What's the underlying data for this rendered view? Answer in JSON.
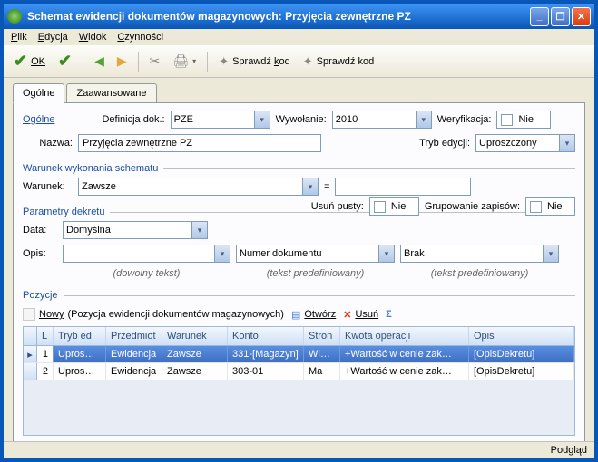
{
  "window": {
    "title": "Schemat ewidencji dokumentów magazynowych: Przyjęcia zewnętrzne PZ"
  },
  "menu": {
    "plik": "Plik",
    "edycja": "Edycja",
    "widok": "Widok",
    "czynnosci": "Czynności"
  },
  "toolbar": {
    "ok": "OK",
    "sprawdz1": "Sprawdź kod",
    "sprawdz2": "Sprawdź kod"
  },
  "tabs": {
    "ogolne": "Ogólne",
    "zaawansowane": "Zaawansowane"
  },
  "form": {
    "ogolne_link": "Ogólne",
    "definicja_lbl": "Definicja dok.:",
    "definicja_val": "PZE",
    "wywolanie_lbl": "Wywołanie:",
    "wywolanie_val": "2010",
    "weryfikacja_lbl": "Weryfikacja:",
    "weryfikacja_val": "Nie",
    "nazwa_lbl": "Nazwa:",
    "nazwa_val": "Przyjęcia zewnętrzne PZ",
    "trybed_lbl": "Tryb edycji:",
    "trybed_val": "Uproszczony"
  },
  "warunek_section": {
    "header": "Warunek wykonania schematu",
    "warunek_lbl": "Warunek:",
    "warunek_val": "Zawsze",
    "eq": "=",
    "rhs": ""
  },
  "param_section": {
    "header": "Parametry dekretu",
    "usun_lbl": "Usuń pusty:",
    "usun_val": "Nie",
    "grup_lbl": "Grupowanie zapisów:",
    "grup_val": "Nie",
    "data_lbl": "Data:",
    "data_val": "Domyślna",
    "opis_lbl": "Opis:",
    "opis_free": "",
    "opis_predef": "Numer dokumentu",
    "opis_brak": "Brak",
    "hint_free": "(dowolny tekst)",
    "hint_predef": "(tekst predefiniowany)"
  },
  "pozycje_section": {
    "header": "Pozycje",
    "nowy": "Nowy",
    "nowy_suffix": "(Pozycja ewidencji dokumentów magazynowych)",
    "otworz": "Otwórz",
    "usun": "Usuń"
  },
  "grid": {
    "cols": {
      "l": "L",
      "tryb": "Tryb ed",
      "przed": "Przedmiot",
      "war": "Warunek",
      "konto": "Konto",
      "stron": "Stron",
      "kwota": "Kwota operacji",
      "opis": "Opis"
    },
    "rows": [
      {
        "l": "1",
        "tryb": "Upros…",
        "przed": "Ewidencja",
        "war": "Zawsze",
        "konto": "331-[Magazyn]",
        "stron": "Wini…",
        "kwota": "+Wartość w cenie zak…",
        "opis": "[OpisDekretu]"
      },
      {
        "l": "2",
        "tryb": "Upros…",
        "przed": "Ewidencja",
        "war": "Zawsze",
        "konto": "303-01",
        "stron": "Ma",
        "kwota": "+Wartość w cenie zak…",
        "opis": "[OpisDekretu]"
      }
    ]
  },
  "status": {
    "podglad": "Podgląd"
  }
}
